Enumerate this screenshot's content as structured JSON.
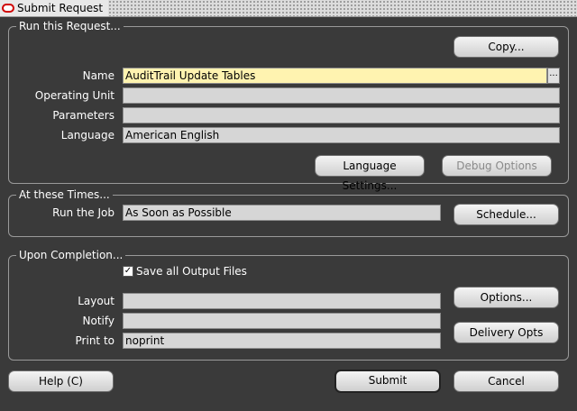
{
  "window": {
    "title": "Submit Request"
  },
  "run_request": {
    "group_title": "Run this Request...",
    "copy_button": "Copy...",
    "name_label": "Name",
    "name_value": "AuditTrail Update Tables",
    "lov_button": "...",
    "operating_unit_label": "Operating Unit",
    "operating_unit_value": "",
    "parameters_label": "Parameters",
    "parameters_value": "",
    "language_label": "Language",
    "language_value": "American English",
    "language_settings_button": "Language Settings...",
    "debug_options_button": "Debug Options"
  },
  "times": {
    "group_title": "At these Times...",
    "run_job_label": "Run the Job",
    "run_job_value": "As Soon as Possible",
    "schedule_button": "Schedule..."
  },
  "completion": {
    "group_title": "Upon Completion...",
    "save_output_label": "Save all Output Files",
    "save_output_checked": true,
    "layout_label": "Layout",
    "layout_value": "",
    "notify_label": "Notify",
    "notify_value": "",
    "print_to_label": "Print to",
    "print_to_value": "noprint",
    "options_button": "Options...",
    "delivery_opts_button": "Delivery Opts"
  },
  "footer": {
    "help_button": "Help (C)",
    "submit_button": "Submit",
    "cancel_button": "Cancel"
  },
  "colors": {
    "background": "#3a3a3a",
    "field": "#d6d6d6",
    "active_field": "#fff3b0",
    "oracle_red": "#d00000"
  },
  "icons": {
    "window_icon": "oracle-logo-icon",
    "check": "checkmark-icon"
  }
}
